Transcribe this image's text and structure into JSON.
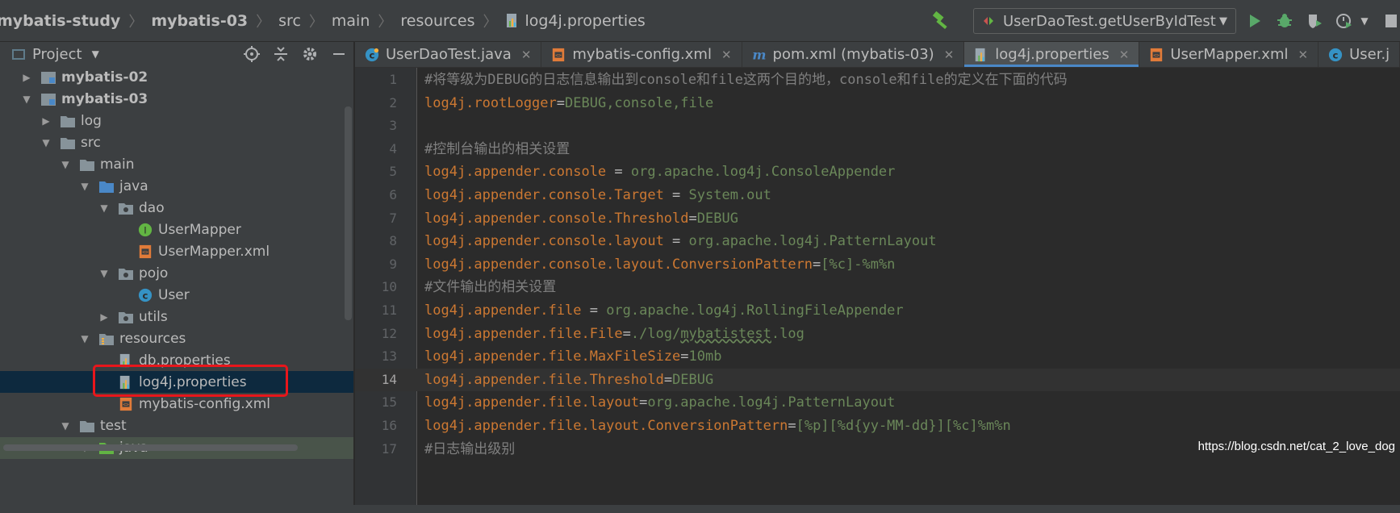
{
  "breadcrumb": {
    "items": [
      "mybatis-study",
      "mybatis-03",
      "src",
      "main",
      "resources",
      "log4j.properties"
    ]
  },
  "run_config": {
    "label": "UserDaoTest.getUserByIdTest"
  },
  "project_panel": {
    "title": "Project",
    "tree": [
      {
        "label": "mybatis-02",
        "depth": 0,
        "arrow": "right",
        "icon": "module-folder-icon",
        "bold": true
      },
      {
        "label": "mybatis-03",
        "depth": 0,
        "arrow": "down",
        "icon": "module-folder-icon",
        "bold": true
      },
      {
        "label": "log",
        "depth": 1,
        "arrow": "right",
        "icon": "folder-icon"
      },
      {
        "label": "src",
        "depth": 1,
        "arrow": "down",
        "icon": "folder-icon"
      },
      {
        "label": "main",
        "depth": 2,
        "arrow": "down",
        "icon": "folder-icon"
      },
      {
        "label": "java",
        "depth": 3,
        "arrow": "down",
        "icon": "source-folder-icon"
      },
      {
        "label": "dao",
        "depth": 4,
        "arrow": "down",
        "icon": "package-icon"
      },
      {
        "label": "UserMapper",
        "depth": 5,
        "arrow": "",
        "icon": "interface-icon"
      },
      {
        "label": "UserMapper.xml",
        "depth": 5,
        "arrow": "",
        "icon": "xml-file-icon"
      },
      {
        "label": "pojo",
        "depth": 4,
        "arrow": "down",
        "icon": "package-icon"
      },
      {
        "label": "User",
        "depth": 5,
        "arrow": "",
        "icon": "class-icon"
      },
      {
        "label": "utils",
        "depth": 4,
        "arrow": "right",
        "icon": "package-icon"
      },
      {
        "label": "resources",
        "depth": 3,
        "arrow": "down",
        "icon": "resources-folder-icon"
      },
      {
        "label": "db.properties",
        "depth": 4,
        "arrow": "",
        "icon": "properties-file-icon"
      },
      {
        "label": "log4j.properties",
        "depth": 4,
        "arrow": "",
        "icon": "properties-file-icon",
        "selected": true
      },
      {
        "label": "mybatis-config.xml",
        "depth": 4,
        "arrow": "",
        "icon": "xml-file-icon"
      },
      {
        "label": "test",
        "depth": 2,
        "arrow": "down",
        "icon": "folder-icon"
      },
      {
        "label": "java",
        "depth": 3,
        "arrow": "down",
        "icon": "test-folder-icon"
      }
    ]
  },
  "tabs": [
    {
      "label": "UserDaoTest.java",
      "icon": "java-class-icon",
      "closable": true
    },
    {
      "label": "mybatis-config.xml",
      "icon": "xml-file-icon",
      "closable": true
    },
    {
      "label": "pom.xml (mybatis-03)",
      "icon": "maven-icon",
      "closable": true
    },
    {
      "label": "log4j.properties",
      "icon": "properties-file-icon",
      "closable": true,
      "active": true
    },
    {
      "label": "UserMapper.xml",
      "icon": "xml-file-icon",
      "closable": true
    },
    {
      "label": "User.j",
      "icon": "class-icon",
      "closable": false
    }
  ],
  "editor": {
    "current_line": 14,
    "lines": [
      {
        "n": "1",
        "comment": "#将等级为DEBUG的日志信息输出到console和file这两个目的地，console和file的定义在下面的代码"
      },
      {
        "n": "2",
        "key": "log4j.rootLogger",
        "sep": "=",
        "value": "DEBUG,console,file"
      },
      {
        "n": "3"
      },
      {
        "n": "4",
        "comment": "#控制台输出的相关设置"
      },
      {
        "n": "5",
        "key": "log4j.appender.console",
        "sep": " = ",
        "value": "org.apache.log4j.ConsoleAppender"
      },
      {
        "n": "6",
        "key": "log4j.appender.console.Target",
        "sep": " = ",
        "value": "System.out"
      },
      {
        "n": "7",
        "key": "log4j.appender.console.Threshold",
        "sep": "=",
        "value": "DEBUG"
      },
      {
        "n": "8",
        "key": "log4j.appender.console.layout",
        "sep": " = ",
        "value": "org.apache.log4j.PatternLayout"
      },
      {
        "n": "9",
        "key": "log4j.appender.console.layout.ConversionPattern",
        "sep": "=",
        "value": "[%c]-%m%n"
      },
      {
        "n": "10",
        "comment": "#文件输出的相关设置"
      },
      {
        "n": "11",
        "key": "log4j.appender.file",
        "sep": " = ",
        "value": "org.apache.log4j.RollingFileAppender"
      },
      {
        "n": "12",
        "key": "log4j.appender.file.File",
        "sep": "=",
        "value_pre": "./log/",
        "value_squiggle": "mybatistest",
        "value_post": ".log"
      },
      {
        "n": "13",
        "key": "log4j.appender.file.MaxFileSize",
        "sep": "=",
        "value": "10mb"
      },
      {
        "n": "14",
        "key": "log4j.appender.file.Threshold",
        "sep": "=",
        "value": "DEBUG"
      },
      {
        "n": "15",
        "key": "log4j.appender.file.layout",
        "sep": "=",
        "value": "org.apache.log4j.PatternLayout"
      },
      {
        "n": "16",
        "key": "log4j.appender.file.layout.ConversionPattern",
        "sep": "=",
        "value": "[%p][%d{yy-MM-dd}][%c]%m%n"
      },
      {
        "n": "17",
        "comment": "#日志输出级别"
      }
    ]
  },
  "watermark": "https://blog.csdn.net/cat_2_love_dog",
  "colors": {
    "key": "#cc7832",
    "value": "#6a8759",
    "comment": "#808080",
    "highlight_box": "#e8161b",
    "active_tab_underline": "#4a88c7"
  }
}
